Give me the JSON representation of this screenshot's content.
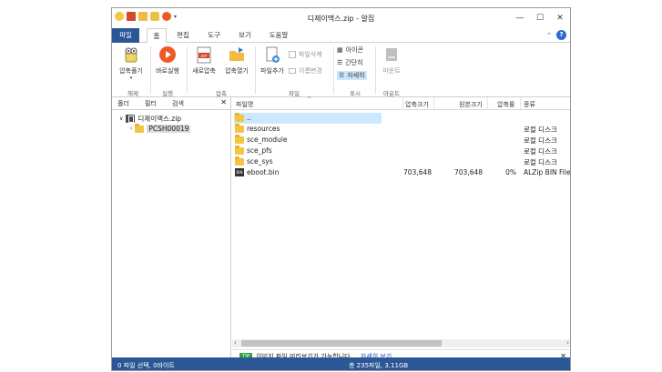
{
  "window": {
    "title": "디제이맥스.zip - 알집",
    "minimize": "—",
    "maximize": "☐",
    "close": "✕"
  },
  "tabs": [
    {
      "label": "파일"
    },
    {
      "label": "홈"
    },
    {
      "label": "편집"
    },
    {
      "label": "도구"
    },
    {
      "label": "보기"
    },
    {
      "label": "도움말"
    }
  ],
  "ribbon": {
    "extract_label": "압축풀기",
    "run_label": "바로실행",
    "new_label": "새로압축",
    "open_label": "압축열기",
    "add_file_label": "파일추가",
    "delete_file_label": "파일삭제",
    "rename_label": "이름변경",
    "icons_label": "아이콘",
    "simple_label": "간단히",
    "detail_label": "자세히",
    "mount_label": "마운트",
    "groups": {
      "extract": "해제",
      "run": "실행",
      "compress": "압축",
      "file": "파일",
      "view": "표시",
      "mount": "마운트"
    }
  },
  "left_pane": {
    "tabs": [
      "폴더",
      "필터",
      "검색"
    ],
    "close": "✕",
    "tree": {
      "root": "디제이맥스.zip",
      "child": "PCSH00019"
    }
  },
  "table": {
    "columns": [
      "파일명",
      "압축크기",
      "원본크기",
      "압축률",
      "종류"
    ],
    "rows": [
      {
        "name": "..",
        "packed": "",
        "original": "",
        "ratio": "",
        "type": "",
        "kind": "folder"
      },
      {
        "name": "resources",
        "packed": "",
        "original": "",
        "ratio": "",
        "type": "로컬 디스크",
        "kind": "folder"
      },
      {
        "name": "sce_module",
        "packed": "",
        "original": "",
        "ratio": "",
        "type": "로컬 디스크",
        "kind": "folder"
      },
      {
        "name": "sce_pfs",
        "packed": "",
        "original": "",
        "ratio": "",
        "type": "로컬 디스크",
        "kind": "folder"
      },
      {
        "name": "sce_sys",
        "packed": "",
        "original": "",
        "ratio": "",
        "type": "로컬 디스크",
        "kind": "folder"
      },
      {
        "name": "eboot.bin",
        "packed": "703,648",
        "original": "703,648",
        "ratio": "0%",
        "type": "ALZip BIN File",
        "kind": "bin"
      }
    ]
  },
  "tip": {
    "badge": "TIP",
    "text": "이미지 파일 미리보기가 가능합니다.",
    "link": "자세히 보기",
    "close": "✕"
  },
  "status": {
    "left": "0 파일 선택, 0바이트",
    "right": "총 235파일, 3.11GB"
  },
  "colors": {
    "accent": "#2b5797",
    "selection": "#cce8ff",
    "folder": "#f5c542"
  }
}
